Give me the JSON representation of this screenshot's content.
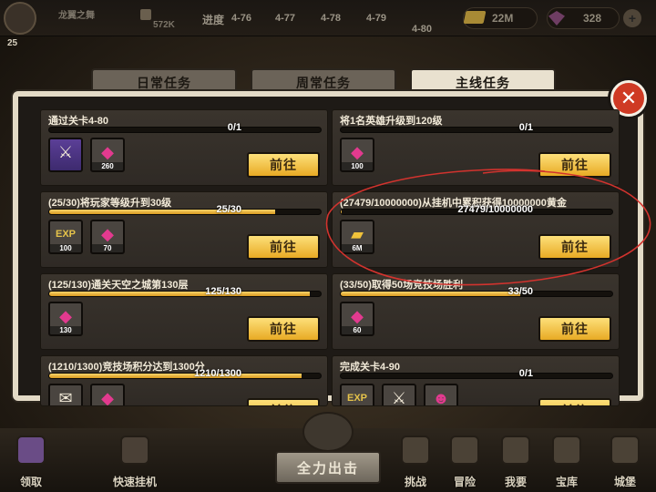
{
  "hud": {
    "player_name": "龙翼之舞",
    "power_value": "572K",
    "progress_label": "进度",
    "stages": [
      "4-76",
      "4-77",
      "4-78",
      "4-79",
      "4-80"
    ],
    "gold": "22M",
    "gems": "328",
    "level": "25"
  },
  "tabs": [
    {
      "label": "日常任务",
      "active": false
    },
    {
      "label": "周常任务",
      "active": false
    },
    {
      "label": "主线任务",
      "active": true
    }
  ],
  "tasks": [
    {
      "title": "通过关卡4-80",
      "progress": "0/1",
      "fill": 0,
      "rewards": [
        {
          "icon": "sword-icon",
          "count": ""
        },
        {
          "icon": "gem-icon",
          "count": "260"
        }
      ],
      "button": "前往"
    },
    {
      "title": "将1名英雄升级到120级",
      "progress": "0/1",
      "fill": 0,
      "rewards": [
        {
          "icon": "gem-icon",
          "count": "100"
        }
      ],
      "button": "前往"
    },
    {
      "title": "(25/30)将玩家等级升到30级",
      "progress": "25/30",
      "fill": 0.833,
      "rewards": [
        {
          "icon": "exp-icon",
          "count": "100"
        },
        {
          "icon": "gem-icon",
          "count": "70"
        }
      ],
      "button": "前往"
    },
    {
      "title": "(27479/10000000)从挂机中累积获得10000000黄金",
      "progress": "27479/10000000",
      "fill": 0.003,
      "rewards": [
        {
          "icon": "gold-bar-icon",
          "count": "6M"
        }
      ],
      "button": "前往"
    },
    {
      "title": "(125/130)通关天空之城第130层",
      "progress": "125/130",
      "fill": 0.96,
      "rewards": [
        {
          "icon": "gem-icon",
          "count": "130"
        }
      ],
      "button": "前往"
    },
    {
      "title": "(33/50)取得50场竞技场胜利",
      "progress": "33/50",
      "fill": 0.66,
      "rewards": [
        {
          "icon": "gem-icon",
          "count": "60"
        }
      ],
      "button": "前往"
    },
    {
      "title": "(1210/1300)竞技场积分达到1300分",
      "progress": "1210/1300",
      "fill": 0.93,
      "rewards": [
        {
          "icon": "scroll-icon",
          "count": ""
        },
        {
          "icon": "gem-icon",
          "count": ""
        }
      ],
      "button": "前往"
    },
    {
      "title": "完成关卡4-90",
      "progress": "0/1",
      "fill": 0,
      "rewards": [
        {
          "icon": "exp-icon",
          "count": ""
        },
        {
          "icon": "sword-icon",
          "count": ""
        },
        {
          "icon": "hero-portrait-icon",
          "count": ""
        }
      ],
      "button": "前往"
    }
  ],
  "nav": {
    "claim": "领取",
    "quick_afk": "快速挂机",
    "fight": "全力出击",
    "challenge": "挑战",
    "adventure": "冒险",
    "heroes": "我要",
    "treasury": "宝库",
    "castle": "城堡"
  },
  "colors": {
    "accent_gold": "#f0b93a",
    "gem_pink": "#e23a8f",
    "close_red": "#cf3a24",
    "annotation_red": "#d2332e"
  }
}
